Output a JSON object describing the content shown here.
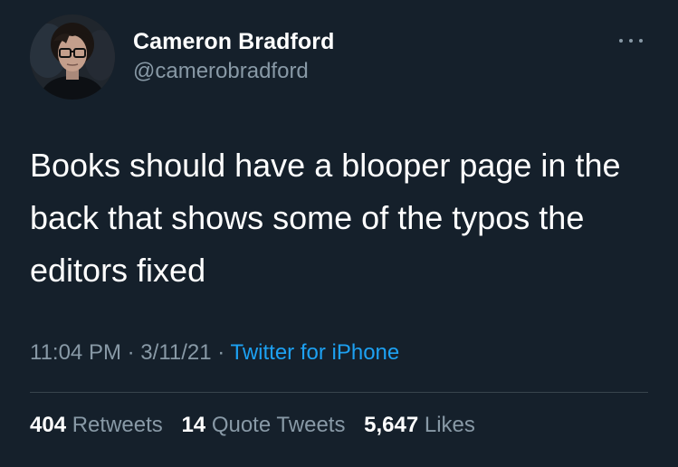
{
  "tweet": {
    "author": {
      "display_name": "Cameron Bradford",
      "handle": "@camerobradford",
      "avatar_icon": "profile-photo"
    },
    "text": "Books should have a blooper page in the back that shows some of the typos the editors fixed",
    "time": "11:04 PM",
    "separator": "·",
    "date": "3/11/21",
    "source": "Twitter for iPhone",
    "stats": {
      "retweets_count": "404",
      "retweets_label": "Retweets",
      "quotes_count": "14",
      "quotes_label": "Quote Tweets",
      "likes_count": "5,647",
      "likes_label": "Likes"
    }
  },
  "colors": {
    "background": "#15202b",
    "text_primary": "#ffffff",
    "text_secondary": "#8899a6",
    "link": "#1da1f2",
    "divider": "#38444d"
  },
  "icons": {
    "more_menu": "more-horizontal-icon"
  }
}
